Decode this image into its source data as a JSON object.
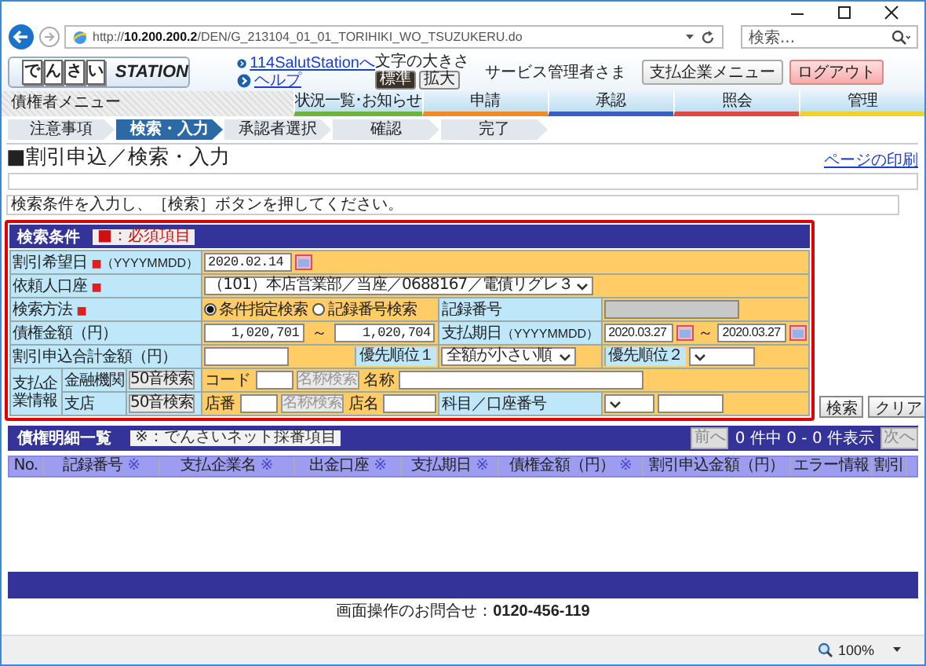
{
  "browser": {
    "url": {
      "prefix": "http://",
      "host": "10.200.200.2",
      "path": "/DEN/G_213104_01_01_TORIHIKI_WO_TSUZUKERU.do"
    },
    "search_placeholder": "検索...",
    "zoom": "100%"
  },
  "header": {
    "logo_chars": [
      "で",
      "ん",
      "さ",
      "い"
    ],
    "logo_text": "STATION",
    "links": [
      "114SalutStationへ",
      "ヘルプ"
    ],
    "font_size_label": "文字の大きさ",
    "font_sizes": [
      {
        "label": "標準",
        "selected": true
      },
      {
        "label": "拡大",
        "selected": false
      }
    ],
    "user": "サービス管理者さま",
    "buttons": [
      {
        "label": "支払企業メニュー",
        "kind": "normal"
      },
      {
        "label": "ログアウト",
        "kind": "logout"
      }
    ]
  },
  "nav": {
    "menu_title": "債権者メニュー",
    "tabs": [
      {
        "label": "状況一覧･お知らせ",
        "color": "#6cb33f"
      },
      {
        "label": "申請",
        "color": "#f08a24"
      },
      {
        "label": "承認",
        "color": "#3b5fc0"
      },
      {
        "label": "照会",
        "color": "#e04848"
      },
      {
        "label": "管理",
        "color": "#f2d22e"
      }
    ]
  },
  "steps": [
    {
      "label": "注意事項",
      "selected": false
    },
    {
      "label": "検索・入力",
      "selected": true
    },
    {
      "label": "承認者選択",
      "selected": false
    },
    {
      "label": "確認",
      "selected": false
    },
    {
      "label": "完了",
      "selected": false
    }
  ],
  "page": {
    "title": "■割引申込／検索・入力",
    "print_link": "ページの印刷",
    "instruction": "検索条件を入力し、［検索］ボタンを押してください。"
  },
  "search_form": {
    "title": "検索条件",
    "legend": "■：必須項目",
    "required_mark": "■",
    "discount_date": {
      "label": "割引希望日",
      "required": true,
      "format": "（YYYYMMDD）",
      "value": "2020.02.14"
    },
    "account": {
      "label": "依頼人口座",
      "required": true,
      "value": "（101）本店営業部／当座／0688167／電債リグレ３"
    },
    "method": {
      "label": "検索方法",
      "required": true,
      "options": [
        {
          "label": "条件指定検索",
          "selected": true
        },
        {
          "label": "記録番号検索",
          "selected": false
        }
      ]
    },
    "record_no": {
      "label": "記録番号",
      "disabled": true
    },
    "amount": {
      "label": "債権金額（円）",
      "from": "1,020,701",
      "to": "1,020,704",
      "separator": "～"
    },
    "due_date": {
      "label": "支払期日",
      "format": "（YYYYMMDD）",
      "from": "2020.03.27",
      "to": "2020.03.27",
      "separator": "～"
    },
    "total": {
      "label": "割引申込合計金額（円）"
    },
    "priority": [
      {
        "label": "優先順位１",
        "value": "全額が小さい順"
      },
      {
        "label": "優先順位２"
      }
    ],
    "payer": {
      "label": "支払企業情報",
      "account_label": "科目／口座番号",
      "bank": {
        "label": "金融機関",
        "kana_button": "50音検索",
        "code_label": "コード",
        "name_search": {
          "label": "名称検索",
          "disabled": true
        },
        "name_label": "名称"
      },
      "branch": {
        "label": "支店",
        "kana_button": "50音検索",
        "code_label": "店番",
        "name_search": {
          "label": "名称検索",
          "disabled": true
        },
        "name_label": "店名"
      }
    },
    "buttons": [
      "検索",
      "クリア"
    ]
  },
  "results": {
    "title": "債権明細一覧",
    "legend": "※：でんさいネット採番項目",
    "prev": {
      "label": "前へ",
      "disabled": true
    },
    "count": "0 件中 0 - 0 件表示",
    "next": {
      "label": "次へ",
      "disabled": true
    },
    "columns": [
      {
        "label": "No."
      },
      {
        "label": "記録番号",
        "mark": "※"
      },
      {
        "label": "支払企業名",
        "mark": "※"
      },
      {
        "label": "出金口座",
        "mark": "※"
      },
      {
        "label": "支払期日",
        "mark": "※"
      },
      {
        "label": "債権金額（円）",
        "mark": "※"
      },
      {
        "label": "割引申込金額（円）"
      },
      {
        "label": "エラー情報"
      },
      {
        "label": "割引"
      }
    ]
  },
  "footer": {
    "contact": "画面操作のお問合せ：**0120-456-119**"
  }
}
